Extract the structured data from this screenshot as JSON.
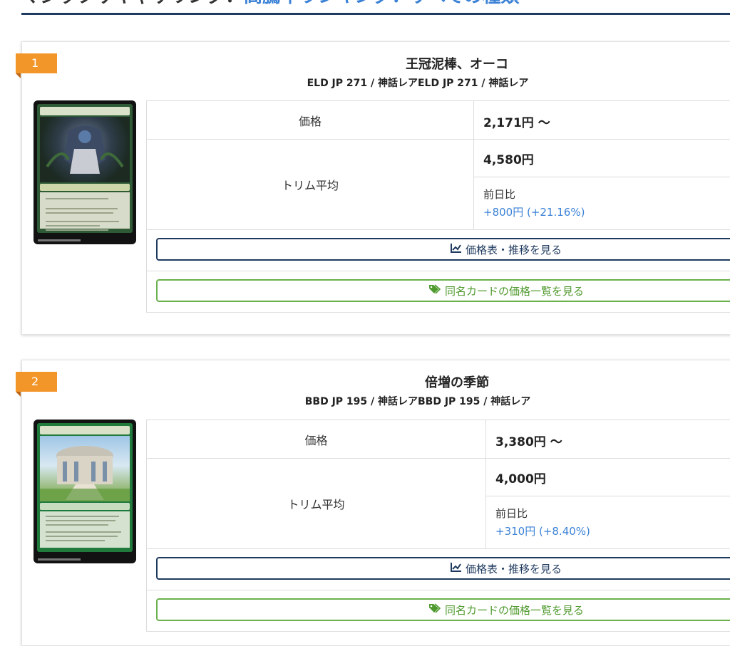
{
  "header": {
    "prefix": "マジックザギャザリング：",
    "highlight": "高騰率ランキング：すべての種類"
  },
  "cards": [
    {
      "rank": "1",
      "name": "王冠泥棒、オーコ",
      "set_info": "ELD JP 271 / 神話レアELD JP 271 / 神話レア",
      "price_label": "価格",
      "price_value": "2,171円 〜",
      "trim_label": "トリム平均",
      "trim_value": "4,580円",
      "prev_label": "前日比",
      "prev_diff": "+800円 (+21.16%)",
      "chart_button": "価格表・推移を見る",
      "same_name_button": "同名カードの価格一覧を見る"
    },
    {
      "rank": "2",
      "name": "倍増の季節",
      "set_info": "BBD JP 195 / 神話レアBBD JP 195 / 神話レア",
      "price_label": "価格",
      "price_value": "3,380円 〜",
      "trim_label": "トリム平均",
      "trim_value": "4,000円",
      "prev_label": "前日比",
      "prev_diff": "+310円 (+8.40%)",
      "chart_button": "価格表・推移を見る",
      "same_name_button": "同名カードの価格一覧を見る"
    }
  ],
  "icons": {
    "chart": "chart-line-icon",
    "tag": "tags-icon"
  },
  "colors": {
    "rank_badge": "#f2962a",
    "accent_navy": "#1f3a5f",
    "accent_green": "#6ab04c",
    "link_blue": "#3b82d6"
  }
}
